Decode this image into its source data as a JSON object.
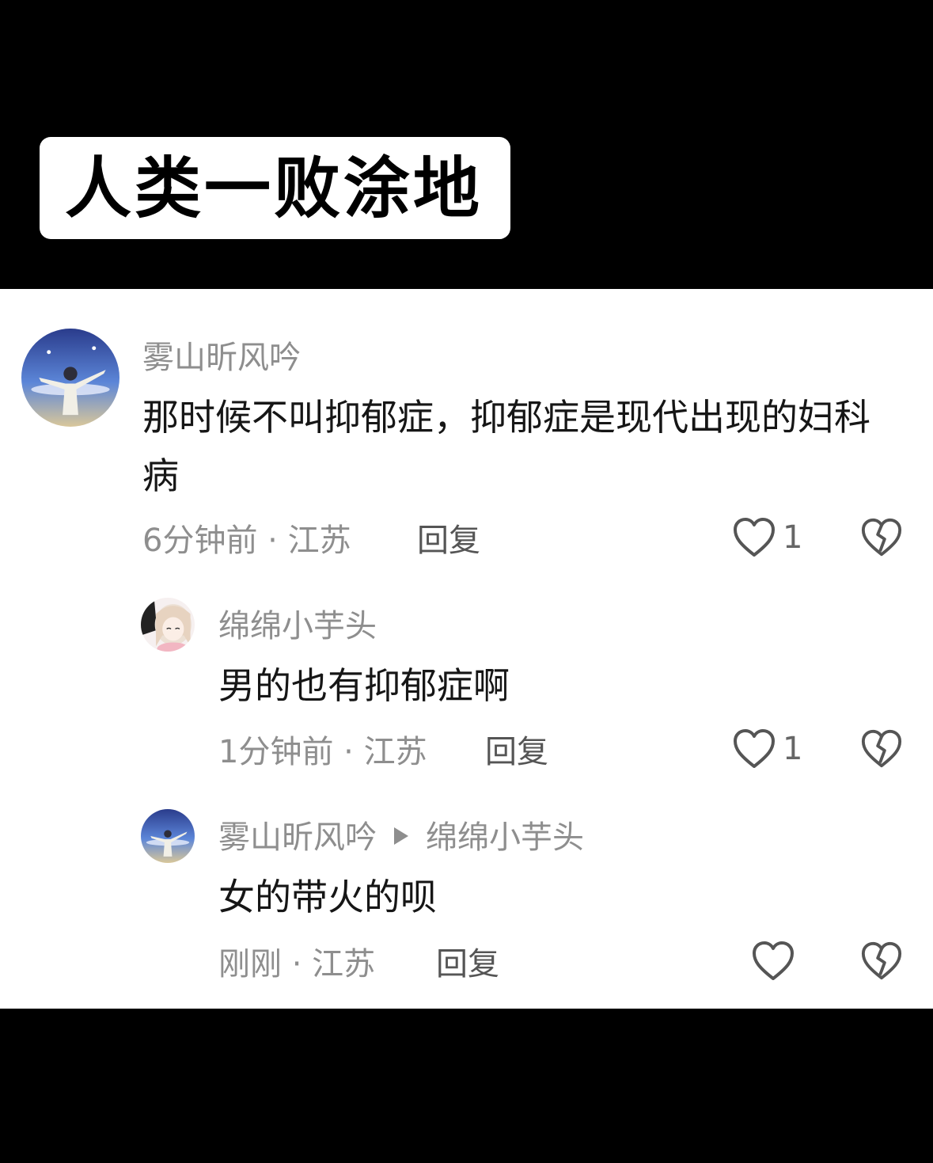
{
  "title": "人类一败涂地",
  "comments": [
    {
      "username": "雾山昕风吟",
      "text": "那时候不叫抑郁症，抑郁症是现代出现的妇科病",
      "time": "6分钟前",
      "location": "江苏",
      "reply_label": "回复",
      "likes": "1",
      "avatar_icon": "avatar-person-sky"
    },
    {
      "username": "绵绵小芋头",
      "text": "男的也有抑郁症啊",
      "time": "1分钟前",
      "location": "江苏",
      "reply_label": "回复",
      "likes": "1",
      "avatar_icon": "avatar-anime-girl"
    },
    {
      "username": "雾山昕风吟",
      "reply_to": "绵绵小芋头",
      "text": "女的带火的呗",
      "time": "刚刚",
      "location": "江苏",
      "reply_label": "回复",
      "likes": "",
      "avatar_icon": "avatar-person-sky"
    }
  ],
  "separator": " · ",
  "colors": {
    "background": "#000000",
    "panel": "#ffffff",
    "username": "#8e8e8e",
    "text": "#161616"
  }
}
